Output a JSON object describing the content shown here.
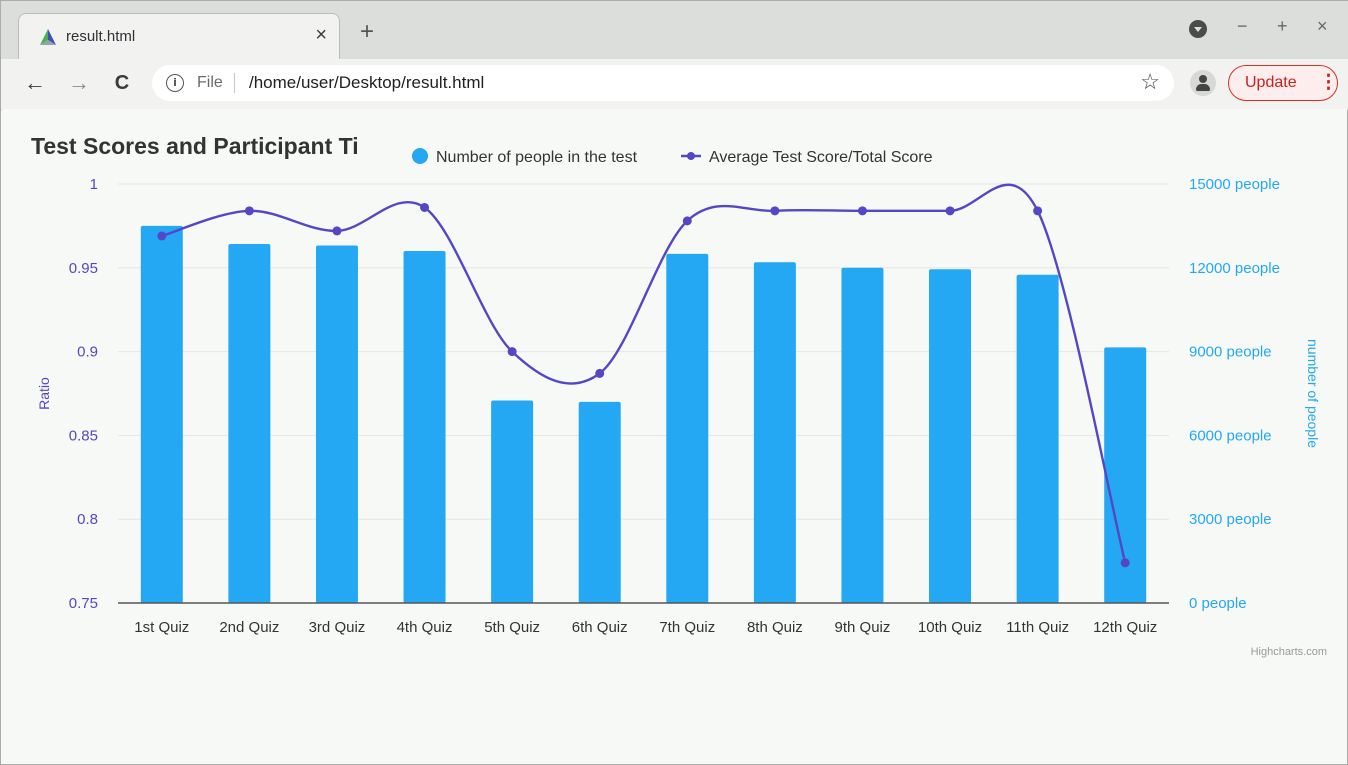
{
  "browser": {
    "tab_title": "result.html",
    "tab_close": "×",
    "new_tab": "+",
    "window_controls": {
      "minimize": "−",
      "maximize": "+",
      "close": "×"
    },
    "nav": {
      "back": "←",
      "forward": "→",
      "reload": "C"
    },
    "address": {
      "scheme_label": "File",
      "url": "/home/user/Desktop/result.html"
    },
    "update_label": "Update",
    "update_menu": "⋮",
    "icons": {
      "favicon": "app-favicon-icon",
      "info": "info-icon",
      "star": "bookmark-star-icon",
      "profile": "profile-icon",
      "menu": "kebab-menu-icon"
    }
  },
  "chart_data": {
    "type": "bar",
    "title": "Test Scores and Participant Ti",
    "credits": "Highcharts.com",
    "categories": [
      "1st Quiz",
      "2nd Quiz",
      "3rd Quiz",
      "4th Quiz",
      "5th Quiz",
      "6th Quiz",
      "7th Quiz",
      "8th Quiz",
      "9th Quiz",
      "10th Quiz",
      "11th Quiz",
      "12th Quiz"
    ],
    "series": [
      {
        "name": "Number of people in the test",
        "type": "column",
        "axis": "right",
        "color": "#24a8f4",
        "values": [
          13500,
          12850,
          12800,
          12600,
          7250,
          7200,
          12500,
          12200,
          12000,
          11950,
          11750,
          9150
        ]
      },
      {
        "name": "Average Test Score/Total Score",
        "type": "spline",
        "axis": "left",
        "color": "#5447c5",
        "values": [
          0.969,
          0.984,
          0.972,
          0.986,
          0.9,
          0.887,
          0.978,
          0.984,
          0.984,
          0.984,
          0.984,
          0.774
        ]
      }
    ],
    "y_left": {
      "label": "Ratio",
      "min": 0.75,
      "max": 1,
      "ticks": [
        "0.75",
        "0.8",
        "0.85",
        "0.9",
        "0.95",
        "1"
      ],
      "color": "#5447c5"
    },
    "y_right": {
      "label": "number of people",
      "min": 0,
      "max": 15000,
      "ticks": [
        "0 people",
        "3000 people",
        "6000 people",
        "9000 people",
        "12000 people",
        "15000 people"
      ],
      "color": "#24a8f4"
    },
    "grid": true,
    "legend_placement": "top-center"
  }
}
